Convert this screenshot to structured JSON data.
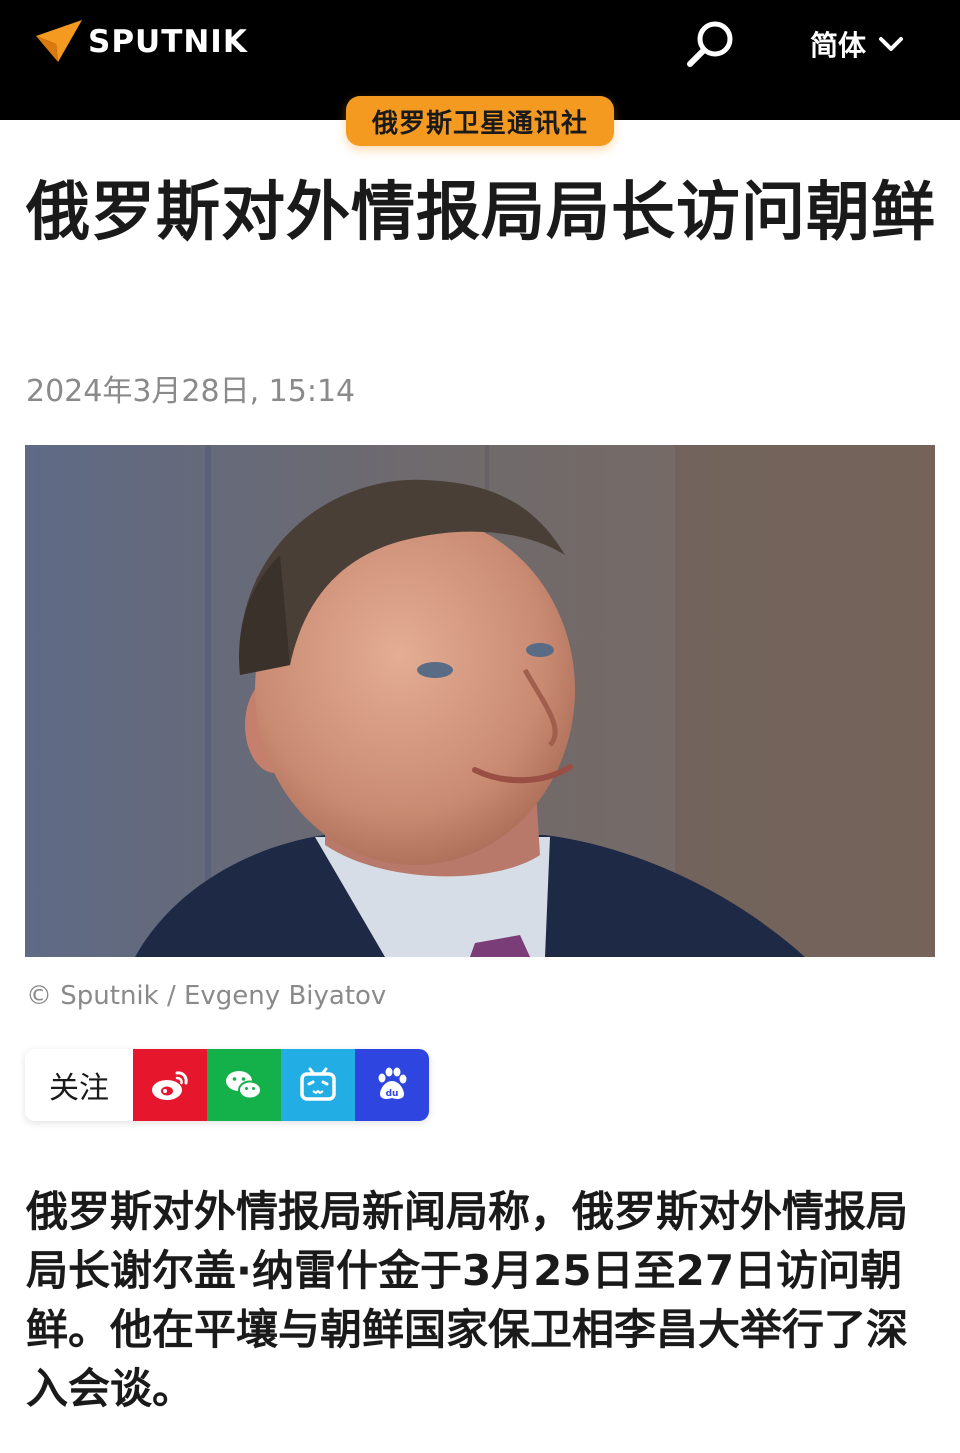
{
  "header": {
    "brand": "SPUTNIK",
    "lang_label": "简体",
    "colors": {
      "bar": "#000000",
      "accent": "#f59a21"
    },
    "icons": {
      "search": "search-icon",
      "language": "chevron-down-icon"
    }
  },
  "badge": {
    "label": "俄罗斯卫星通讯社"
  },
  "article": {
    "title": "俄罗斯对外情报局局长访问朝鲜",
    "date": "2024年3月28日, 15:14",
    "image_credit": "© Sputnik / Evgeny Biyatov",
    "body": "俄罗斯对外情报局新闻局称，俄罗斯对外情报局局长谢尔盖·纳雷什金于3月25日至27日访问朝鲜。他在平壤与朝鲜国家保卫相李昌大举行了深入会谈。"
  },
  "share": {
    "label": "关注",
    "buttons": [
      {
        "name": "weibo",
        "icon": "weibo-icon",
        "color": "#e6162d"
      },
      {
        "name": "wechat",
        "icon": "wechat-icon",
        "color": "#14b14a"
      },
      {
        "name": "bilibili",
        "icon": "bilibili-icon",
        "color": "#23ade5"
      },
      {
        "name": "baidu",
        "icon": "baidu-icon",
        "color": "#2e45df"
      }
    ]
  }
}
